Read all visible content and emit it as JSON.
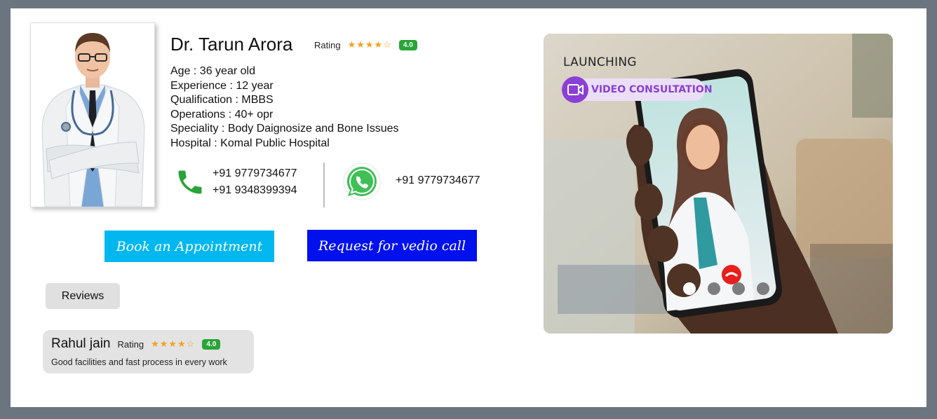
{
  "doctor": {
    "name": "Dr. Tarun Arora",
    "rating_label": "Rating",
    "stars": "★★★★☆",
    "rating_value": "4.0",
    "details": [
      "Age :  36 year old",
      "Experience : 12 year",
      "Qualification : MBBS",
      "Operations : 40+ opr",
      "Speciality : Body Daignosize and Bone Issues",
      "Hospital : Komal Public Hospital"
    ],
    "phones": [
      "+91 9779734677",
      "+91 9348399394"
    ],
    "whatsapp": "+91 9779734677",
    "icons": {
      "phone": "phone-icon",
      "whatsapp": "whatsapp-icon"
    }
  },
  "actions": {
    "book_label": "Book an Appointment",
    "call_label": "Request for vedio call"
  },
  "reviews": {
    "button_label": "Reviews",
    "items": [
      {
        "name": "Rahul jain",
        "rating_label": "Rating",
        "stars": "★★★★☆",
        "rating_value": "4.0",
        "text": "Good facilities and fast process in every work"
      }
    ]
  },
  "promo": {
    "kicker": "LAUNCHING",
    "title": "VIDEO CONSULTATION",
    "icon": "video-camera-icon",
    "slides": 4,
    "active_slide": 1
  },
  "colors": {
    "book_button": "#00b7f0",
    "call_button": "#0011ee",
    "rating_badge": "#2aa43a",
    "star": "#f6a11a",
    "promo_accent": "#8a3fd6",
    "page_border": "#6b7580"
  }
}
